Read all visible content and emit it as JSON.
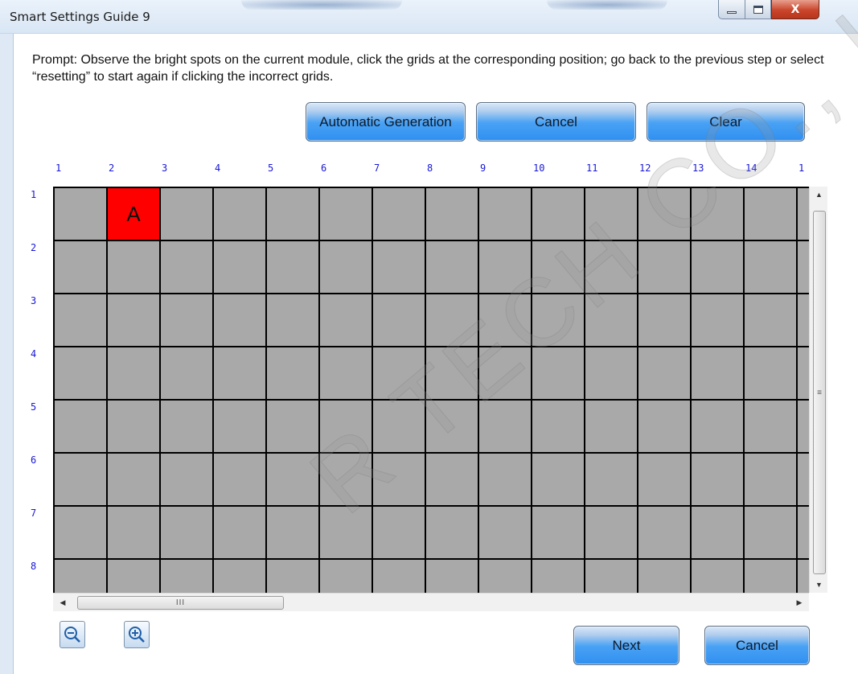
{
  "window": {
    "title": "Smart Settings Guide 9",
    "minimize_glyph": "—",
    "close_glyph": "X"
  },
  "prompt": "Prompt: Observe the bright spots on the current module, click the grids at the corresponding position; go back to the previous step or select “resetting” to start again if clicking the incorrect grids.",
  "toolbar": {
    "auto_label": "Automatic Generation",
    "cancel_label": "Cancel",
    "clear_label": "Clear"
  },
  "grid": {
    "column_labels": [
      "1",
      "2",
      "3",
      "4",
      "5",
      "6",
      "7",
      "8",
      "9",
      "10",
      "11",
      "12",
      "13",
      "14",
      "1"
    ],
    "row_labels": [
      "1",
      "2",
      "3",
      "4",
      "5",
      "6",
      "7",
      "8"
    ],
    "rows": 8,
    "columns": 15,
    "marked_cells": [
      {
        "row": 1,
        "col": 2,
        "label": "A"
      }
    ],
    "cell_color": "#a9a9a9",
    "marked_color": "#ff0000"
  },
  "scrollbar": {
    "thumb_grip": "≡",
    "h_thumb_grip": "III"
  },
  "footer": {
    "next_label": "Next",
    "cancel_label": "Cancel"
  },
  "icons": {
    "zoom_out": "zoom-out-icon",
    "zoom_in": "zoom-in-icon"
  },
  "watermark": "R TECH CO., LTD"
}
